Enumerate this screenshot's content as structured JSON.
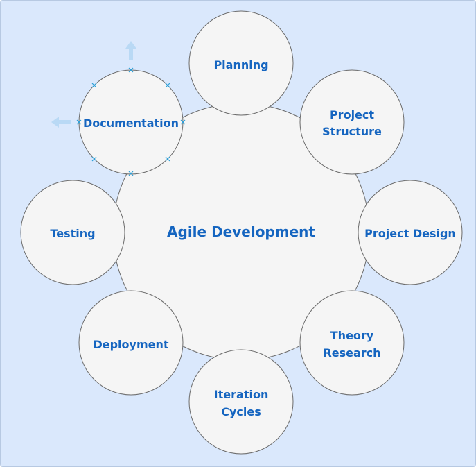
{
  "center": {
    "label": "Agile Development"
  },
  "nodes": [
    {
      "id": "planning",
      "lines": [
        "Planning"
      ]
    },
    {
      "id": "project-structure",
      "lines": [
        "Project",
        "Structure"
      ]
    },
    {
      "id": "project-design",
      "lines": [
        "Project Design"
      ]
    },
    {
      "id": "theory-research",
      "lines": [
        "Theory",
        "Research"
      ]
    },
    {
      "id": "iteration-cycles",
      "lines": [
        "Iteration",
        "Cycles"
      ]
    },
    {
      "id": "deployment",
      "lines": [
        "Deployment"
      ]
    },
    {
      "id": "testing",
      "lines": [
        "Testing"
      ]
    },
    {
      "id": "documentation",
      "lines": [
        "Documentation"
      ],
      "selected": true
    }
  ],
  "colors": {
    "background": "#dae8fc",
    "node_fill": "#f5f5f5",
    "node_stroke": "#6b6b6b",
    "label": "#1565c0",
    "selection_handle": "#2b9fd8",
    "drag_arrow": "#b9d9f5"
  },
  "icons": {
    "selection_handles": "x-handle-icon",
    "move_arrows": [
      "arrow-up-icon",
      "arrow-left-icon"
    ]
  }
}
